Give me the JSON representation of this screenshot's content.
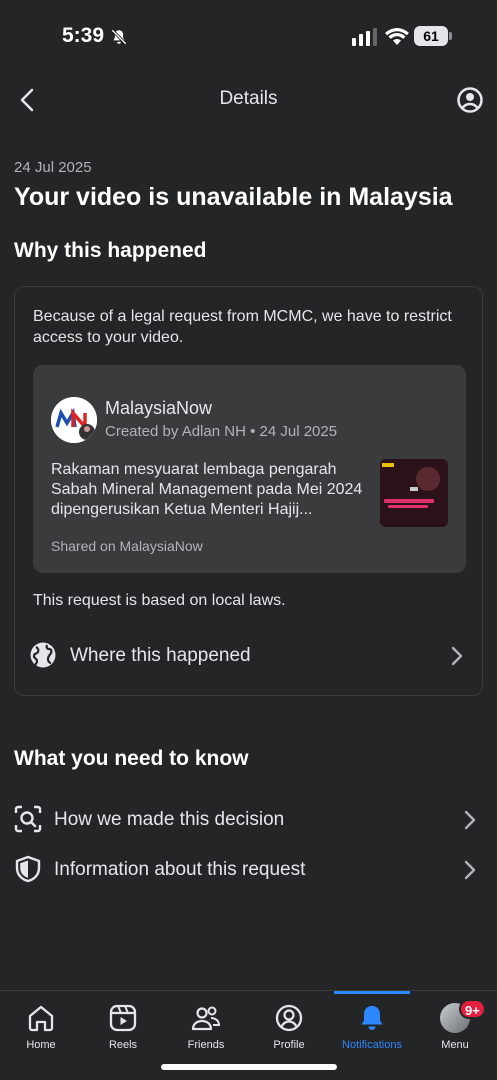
{
  "status_bar": {
    "time": "5:39",
    "battery": "61"
  },
  "header": {
    "title": "Details"
  },
  "notice": {
    "date": "24 Jul 2025",
    "title": "Your video is unavailable in Malaysia"
  },
  "why_section": {
    "title": "Why this happened",
    "explanation": "Because of a legal request from MCMC, we have to restrict access to your video.",
    "post": {
      "page_name": "MalaysiaNow",
      "meta": "Created by Adlan NH • 24 Jul 2025",
      "body": "Rakaman mesyuarat lembaga pengarah Sabah Mineral Management pada Mei 2024 dipengerusikan Ketua Menteri Hajij...",
      "shared": "Shared on MalaysiaNow"
    },
    "basis": "This request is based on local laws.",
    "where_label": "Where this happened"
  },
  "know_section": {
    "title": "What you need to know",
    "items": [
      {
        "label": "How we made this decision",
        "icon": "scan-search-icon"
      },
      {
        "label": "Information about this request",
        "icon": "shield-icon"
      }
    ]
  },
  "tab_bar": {
    "tabs": [
      {
        "label": "Home",
        "icon": "home-icon"
      },
      {
        "label": "Reels",
        "icon": "reels-icon"
      },
      {
        "label": "Friends",
        "icon": "friends-icon"
      },
      {
        "label": "Profile",
        "icon": "profile-icon"
      },
      {
        "label": "Notifications",
        "icon": "bell-icon",
        "active": true
      },
      {
        "label": "Menu",
        "icon": "menu-avatar"
      }
    ],
    "menu_badge": "9+"
  },
  "colors": {
    "background": "#242526",
    "accent": "#2d88ff",
    "badge": "#e41e3f"
  }
}
